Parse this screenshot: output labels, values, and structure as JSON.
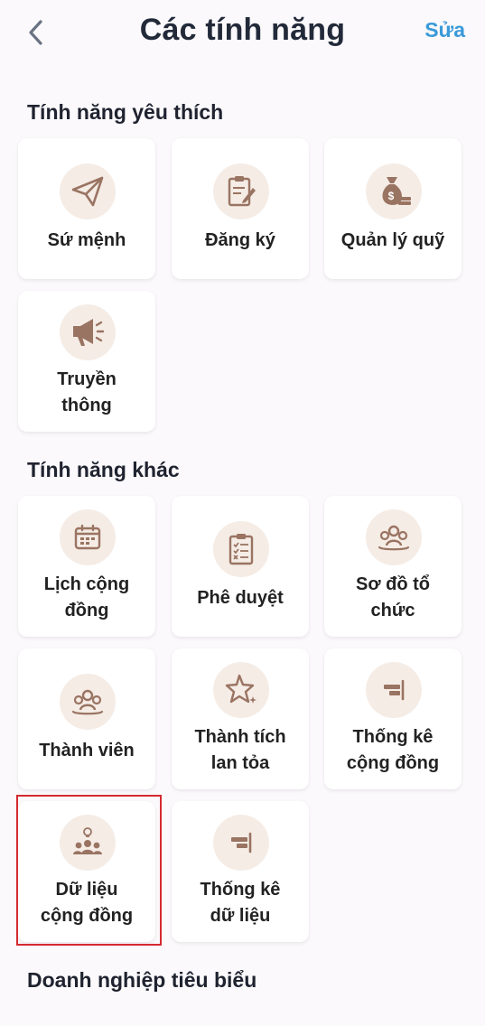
{
  "header": {
    "title": "Các tính năng",
    "edit_label": "Sửa"
  },
  "sections": {
    "favorite": {
      "title": "Tính năng yêu thích"
    },
    "other": {
      "title": "Tính năng khác"
    },
    "business": {
      "title": "Doanh nghiệp tiêu biểu"
    }
  },
  "favorites": [
    {
      "label": "Sứ mệnh",
      "icon": "paper-plane-icon"
    },
    {
      "label": "Đăng ký",
      "icon": "clipboard-edit-icon"
    },
    {
      "label": "Quản lý quỹ",
      "icon": "money-bag-icon"
    },
    {
      "label": "Truyền\nthông",
      "icon": "megaphone-icon"
    }
  ],
  "others": [
    {
      "label": "Lịch cộng\nđồng",
      "icon": "calendar-icon"
    },
    {
      "label": "Phê duyệt",
      "icon": "checklist-icon"
    },
    {
      "label": "Sơ đồ tổ\nchức",
      "icon": "group-circle-icon"
    },
    {
      "label": "Thành viên",
      "icon": "members-icon"
    },
    {
      "label": "Thành tích\nlan tỏa",
      "icon": "star-sparkle-icon"
    },
    {
      "label": "Thống kê\ncộng đồng",
      "icon": "bar-align-icon"
    },
    {
      "label": "Dữ liệu\ncộng đồng",
      "icon": "community-idea-icon"
    },
    {
      "label": "Thống kê\ndữ liệu",
      "icon": "bar-align-icon"
    }
  ],
  "colors": {
    "icon_brown": "#9a7462",
    "icon_bg": "#f5ece6",
    "accent_blue": "#3a9ad9",
    "highlight_red": "#d42a30"
  }
}
